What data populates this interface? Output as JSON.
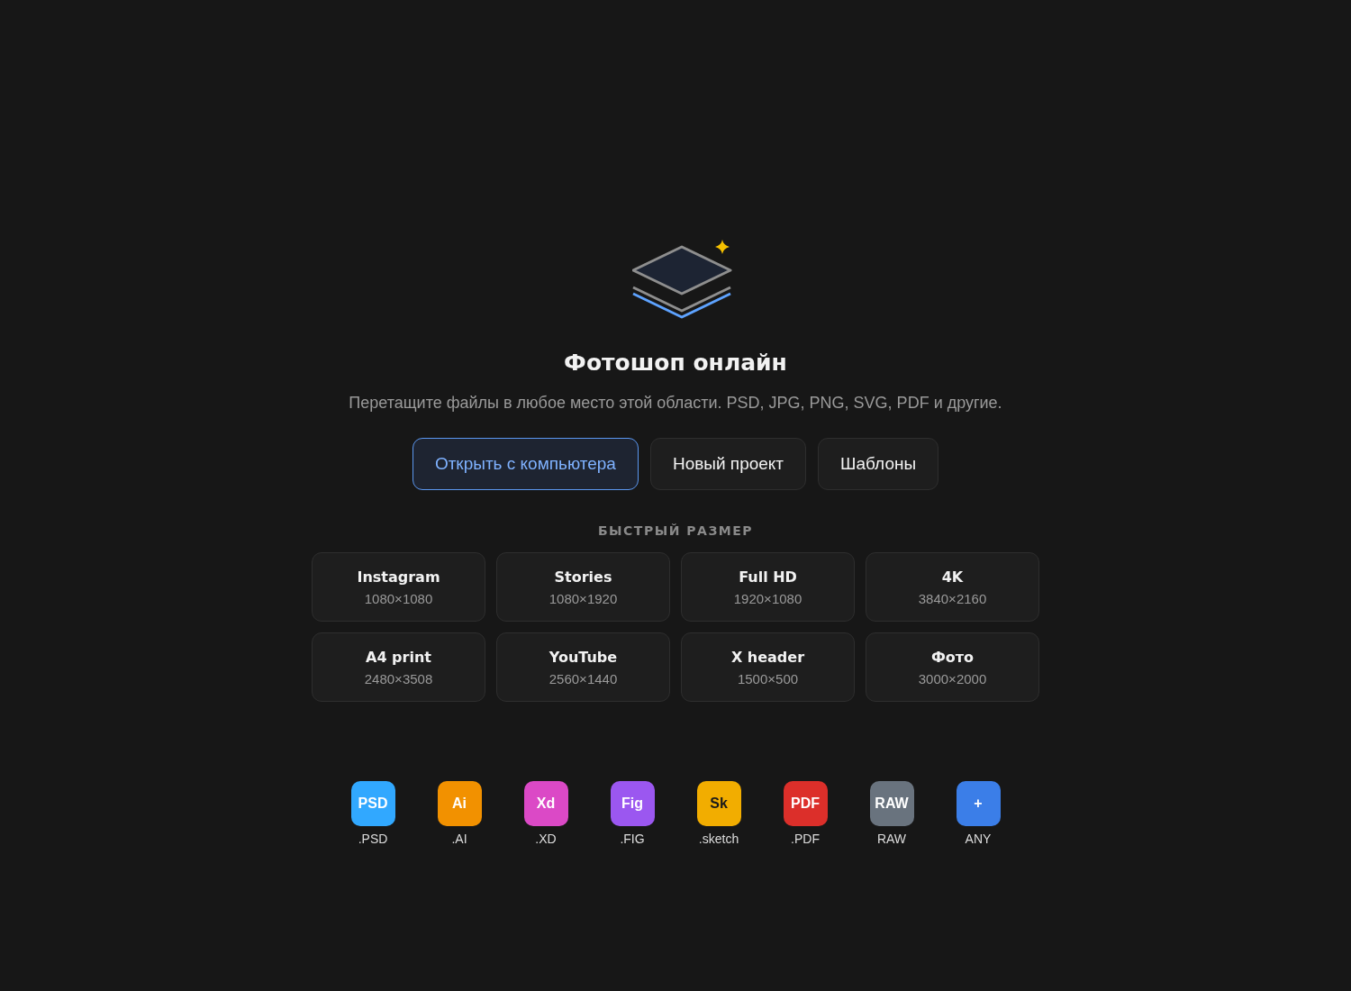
{
  "title": "Фотошоп онлайн",
  "subtitle": "Перетащите файлы в любое место этой области. PSD, JPG, PNG, SVG, PDF и другие.",
  "buttons": [
    {
      "label": "Открыть с компьютера",
      "kind": "primary"
    },
    {
      "label": "Новый проект",
      "kind": "secondary"
    },
    {
      "label": "Шаблоны",
      "kind": "secondary"
    }
  ],
  "quick_size": {
    "heading": "БЫСТРЫЙ РАЗМЕР",
    "presets": [
      {
        "name": "Instagram",
        "size": "1080×1080"
      },
      {
        "name": "Stories",
        "size": "1080×1920"
      },
      {
        "name": "Full HD",
        "size": "1920×1080"
      },
      {
        "name": "4K",
        "size": "3840×2160"
      },
      {
        "name": "A4 print",
        "size": "2480×3508"
      },
      {
        "name": "YouTube",
        "size": "2560×1440"
      },
      {
        "name": "X header",
        "size": "1500×500"
      },
      {
        "name": "Фото",
        "size": "3000×2000"
      }
    ]
  },
  "formats": [
    {
      "badge": "PSD",
      "label": ".PSD",
      "color": "#31a8ff"
    },
    {
      "badge": "Ai",
      "label": ".AI",
      "color": "#f29100"
    },
    {
      "badge": "Xd",
      "label": ".XD",
      "color": "#db49c6"
    },
    {
      "badge": "Fig",
      "label": ".FIG",
      "color": "#9b57f0"
    },
    {
      "badge": "Sk",
      "label": ".sketch",
      "color": "#f2ad00"
    },
    {
      "badge": "PDF",
      "label": ".PDF",
      "color": "#dc2f2a"
    },
    {
      "badge": "RAW",
      "label": "RAW",
      "color": "#69737e"
    },
    {
      "badge": "+",
      "label": "ANY",
      "color": "#3b7ee8"
    }
  ]
}
